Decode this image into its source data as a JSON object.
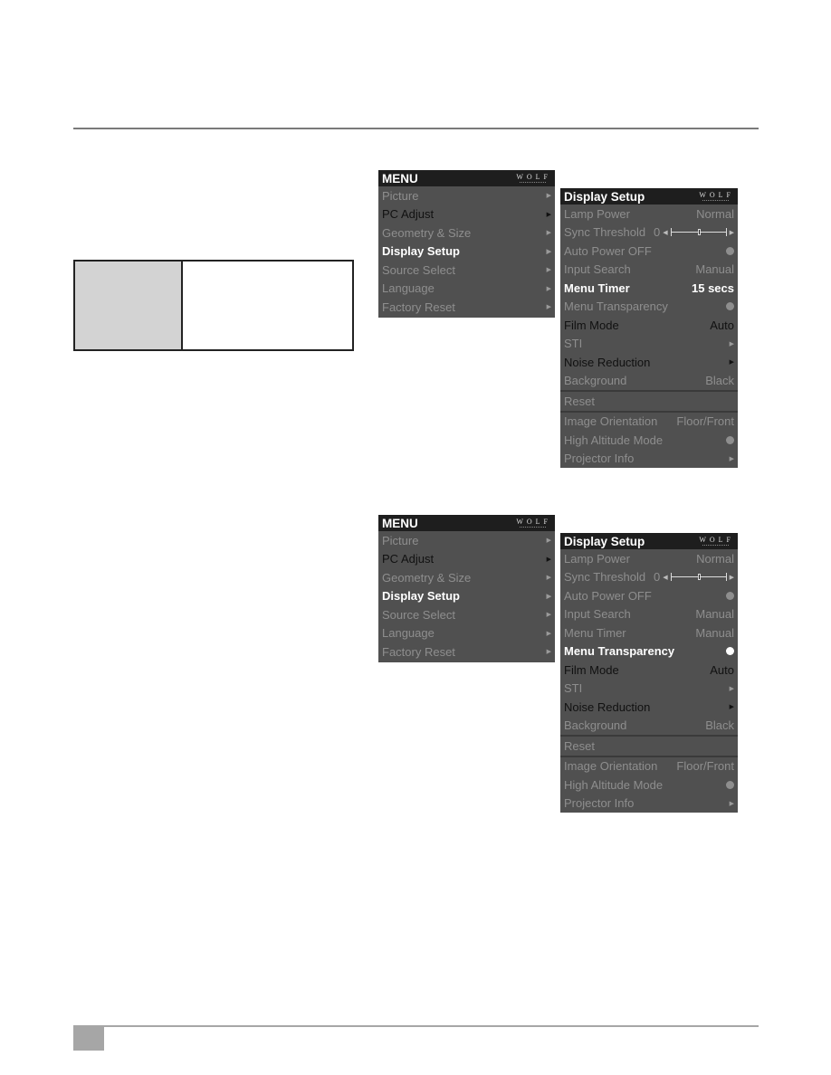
{
  "main_menu": {
    "title": "MENU",
    "logo": "WOLF",
    "items": [
      {
        "label": "Picture",
        "state": "dim",
        "icon": "chevron-right-icon"
      },
      {
        "label": "PC Adjust",
        "state": "dark",
        "icon": "chevron-right-icon"
      },
      {
        "label": "Geometry & Size",
        "state": "dim",
        "icon": "chevron-right-icon"
      },
      {
        "label": "Display Setup",
        "state": "selected",
        "icon": "chevron-right-icon"
      },
      {
        "label": "Source Select",
        "state": "dim",
        "icon": "chevron-right-icon"
      },
      {
        "label": "Language",
        "state": "dim",
        "icon": "chevron-right-icon"
      },
      {
        "label": "Factory Reset",
        "state": "dim",
        "icon": "chevron-right-icon"
      }
    ]
  },
  "display_setup_1": {
    "title": "Display Setup",
    "logo": "WOLF",
    "items": [
      {
        "label": "Lamp Power",
        "value": "Normal"
      },
      {
        "label": "Sync Threshold",
        "value": "0",
        "slider": 0.5
      },
      {
        "label": "Auto Power OFF",
        "toggle": "off"
      },
      {
        "label": "Input Search",
        "value": "Manual"
      },
      {
        "label": "Menu Timer",
        "value": "15 secs",
        "selected": true
      },
      {
        "label": "Menu Transparency",
        "toggle": "off"
      },
      {
        "label": "Film Mode",
        "value": "Auto",
        "dark": true
      },
      {
        "label": "STI",
        "submenu": true
      },
      {
        "label": "Noise Reduction",
        "submenu": true,
        "dark": true
      },
      {
        "label": "Background",
        "value": "Black"
      },
      {
        "label": "Reset"
      },
      {
        "label": "Image Orientation",
        "value": "Floor/Front"
      },
      {
        "label": "High Altitude Mode",
        "toggle": "off"
      },
      {
        "label": "Projector Info",
        "submenu": true
      }
    ]
  },
  "display_setup_2": {
    "title": "Display Setup",
    "logo": "WOLF",
    "items": [
      {
        "label": "Lamp Power",
        "value": "Normal"
      },
      {
        "label": "Sync Threshold",
        "value": "0",
        "slider": 0.5
      },
      {
        "label": "Auto Power OFF",
        "toggle": "off"
      },
      {
        "label": "Input Search",
        "value": "Manual"
      },
      {
        "label": "Menu Timer",
        "value": "Manual"
      },
      {
        "label": "Menu Transparency",
        "toggle": "on",
        "selected": true
      },
      {
        "label": "Film Mode",
        "value": "Auto",
        "dark": true
      },
      {
        "label": "STI",
        "submenu": true
      },
      {
        "label": "Noise Reduction",
        "submenu": true,
        "dark": true
      },
      {
        "label": "Background",
        "value": "Black"
      },
      {
        "label": "Reset"
      },
      {
        "label": "Image Orientation",
        "value": "Floor/Front"
      },
      {
        "label": "High Altitude Mode",
        "toggle": "off"
      },
      {
        "label": "Projector Info",
        "submenu": true
      }
    ]
  }
}
